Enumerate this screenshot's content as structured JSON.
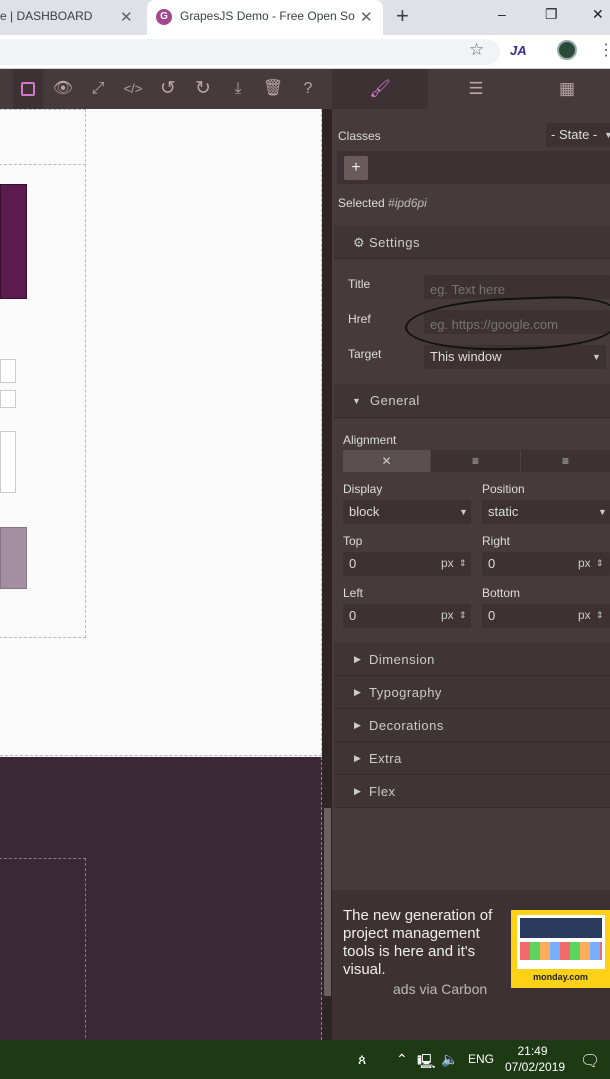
{
  "browser": {
    "tabs": [
      {
        "label": "e | DASHBOARD",
        "active": false
      },
      {
        "label": "GrapesJS Demo - Free Open Sou",
        "active": true
      }
    ],
    "new_tab": "+",
    "window_controls": [
      "–",
      "❐",
      "✕"
    ],
    "extension_label": "JA"
  },
  "toolbar": {
    "tools": [
      "sw-visibility-icon",
      "preview-icon",
      "fullscreen-icon",
      "code-icon",
      "undo-icon",
      "redo-icon",
      "download-icon",
      "trash-icon",
      "help-icon"
    ]
  },
  "right_tabs": [
    "style-manager-icon",
    "layer-manager-icon",
    "blocks-icon"
  ],
  "panel": {
    "classes_label": "Classes",
    "state_select": "- State -",
    "add_class": "+",
    "selected_label": "Selected",
    "selected_id": "#ipd6pi",
    "settings": {
      "title": "Settings",
      "fields": [
        {
          "label": "Title",
          "placeholder": "eg. Text here",
          "value": ""
        },
        {
          "label": "Href",
          "placeholder": "eg. https://google.com",
          "value": ""
        },
        {
          "label": "Target",
          "value": "This window"
        }
      ]
    },
    "general": {
      "title": "General",
      "alignment_label": "Alignment",
      "alignment_options": [
        "✕",
        "≡",
        "≡"
      ],
      "display_label": "Display",
      "display_value": "block",
      "position_label": "Position",
      "position_value": "static",
      "top_label": "Top",
      "top_value": "0",
      "right_label": "Right",
      "right_value": "0",
      "left_label": "Left",
      "left_value": "0",
      "bottom_label": "Bottom",
      "bottom_value": "0",
      "unit": "px"
    },
    "sections": [
      "Dimension",
      "Typography",
      "Decorations",
      "Extra",
      "Flex"
    ],
    "ad": {
      "text": "The new generation of project management tools is here and it's visual.",
      "via": "ads via Carbon",
      "brand": "monday.com"
    }
  },
  "taskbar": {
    "lang": "ENG",
    "time": "21:49",
    "date": "07/02/2019"
  },
  "colors": {
    "panel_bg": "#463a3c",
    "accent": "#d278c9",
    "taskbar": "#1d3a14"
  }
}
